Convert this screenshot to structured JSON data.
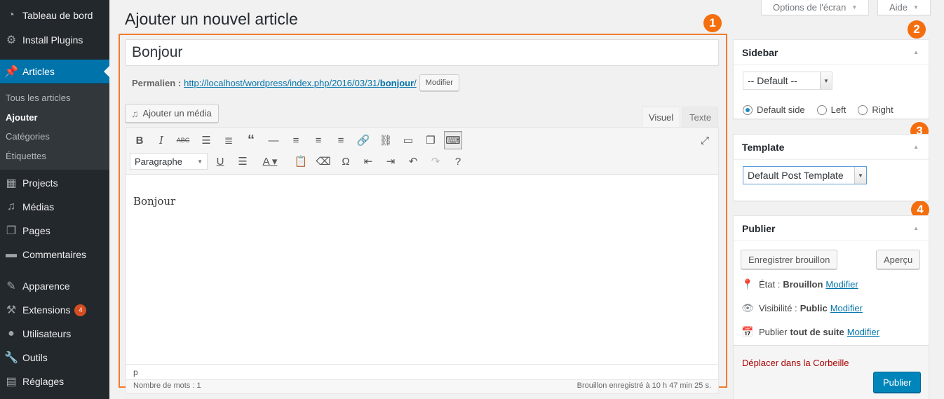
{
  "colors": {
    "sidebar_bg": "#23282d",
    "accent": "#0073aa",
    "annotation": "#f56e0e",
    "publish": "#0085ba"
  },
  "sidebar": {
    "items": [
      {
        "label": "Tableau de bord",
        "icon": "dashboard-icon"
      },
      {
        "label": "Install Plugins",
        "icon": "gear-icon"
      },
      {
        "label": "Articles",
        "icon": "pin-icon"
      },
      {
        "label": "Projects",
        "icon": "portfolio-icon"
      },
      {
        "label": "Médias",
        "icon": "media-icon"
      },
      {
        "label": "Pages",
        "icon": "pages-icon"
      },
      {
        "label": "Commentaires",
        "icon": "comment-icon"
      },
      {
        "label": "Apparence",
        "icon": "brush-icon"
      },
      {
        "label": "Extensions",
        "icon": "plugin-icon",
        "badge": "4"
      },
      {
        "label": "Utilisateurs",
        "icon": "user-icon"
      },
      {
        "label": "Outils",
        "icon": "wrench-icon"
      },
      {
        "label": "Réglages",
        "icon": "settings-icon"
      }
    ],
    "submenu": [
      "Tous les articles",
      "Ajouter",
      "Catégories",
      "Étiquettes"
    ]
  },
  "header": {
    "title": "Ajouter un nouvel article",
    "screen_options": "Options de l'écran",
    "help": "Aide"
  },
  "annotations": [
    "1",
    "2",
    "3",
    "4"
  ],
  "post": {
    "title": "Bonjour",
    "permalink_label": "Permalien :",
    "permalink_base": "http://localhost/wordpress/index.php/2016/03/31/",
    "permalink_slug": "bonjour",
    "permalink_end": "/",
    "modify_button": "Modifier",
    "add_media": "Ajouter un média",
    "tab_visual": "Visuel",
    "tab_text": "Texte",
    "format": "Paragraphe",
    "content": "Bonjour",
    "path": "p",
    "word_count": "Nombre de mots : 1",
    "autosave": "Brouillon enregistré à 10 h 47 min 25 s."
  },
  "sidebar_box": {
    "title": "Sidebar",
    "select_value": "-- Default --",
    "radios": [
      {
        "label": "Default side",
        "checked": true
      },
      {
        "label": "Left",
        "checked": false
      },
      {
        "label": "Right",
        "checked": false
      }
    ]
  },
  "template_box": {
    "title": "Template",
    "select_value": "Default Post Template"
  },
  "publish_box": {
    "title": "Publier",
    "save_draft": "Enregistrer brouillon",
    "preview": "Aperçu",
    "status_label": "État :",
    "status_value": "Brouillon",
    "visibility_label": "Visibilité :",
    "visibility_value": "Public",
    "schedule_label": "Publier",
    "schedule_value": "tout de suite",
    "modify": "Modifier",
    "trash": "Déplacer dans la Corbeille",
    "publish": "Publier"
  }
}
